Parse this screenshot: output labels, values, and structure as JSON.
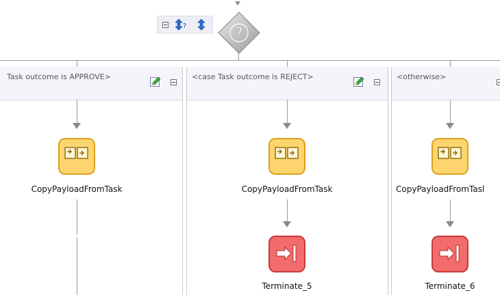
{
  "switch": {
    "icon": "question-diamond-icon",
    "toolbar": {
      "collapse_icon": "collapse-icon",
      "expand_icon": "expand-switch-icon",
      "sort_icon": "sort-cases-icon"
    }
  },
  "branches": [
    {
      "label": "Task outcome is APPROVE>",
      "activity": {
        "label": "CopyPayloadFromTask",
        "icon": "assign-icon"
      }
    },
    {
      "label": "<case Task outcome is REJECT>",
      "activity": {
        "label": "CopyPayloadFromTask",
        "icon": "assign-icon"
      },
      "terminate": {
        "label": "Terminate_5",
        "icon": "terminate-icon"
      }
    },
    {
      "label": "<otherwise>",
      "activity": {
        "label": "CopyPayloadFromTasl",
        "icon": "assign-icon"
      },
      "terminate": {
        "label": "Terminate_6",
        "icon": "terminate-icon"
      }
    }
  ],
  "colors": {
    "assign_fill": "#fdd46e",
    "assign_border": "#d9a21e",
    "terminate_fill": "#f26c6c",
    "terminate_border": "#c83a3a",
    "header_bg": "#f5f4fa",
    "connector": "#9a9a9a"
  }
}
